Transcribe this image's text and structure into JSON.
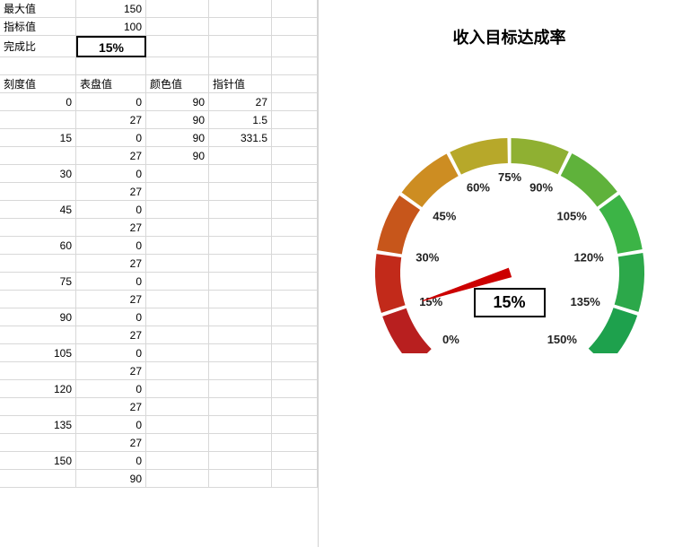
{
  "labels": {
    "max": "最大值",
    "target": "指标值",
    "completion": "完成比",
    "tick_col": "刻度值",
    "dial_col": "表盘值",
    "color_col": "颜色值",
    "needle_col": "指针值"
  },
  "values": {
    "max": "150",
    "target": "100",
    "completion": "15%"
  },
  "header_row": [
    "刻度值",
    "表盘值",
    "颜色值",
    "指针值"
  ],
  "data_rows": [
    [
      "0",
      "0",
      "90",
      "27"
    ],
    [
      "",
      "27",
      "90",
      "1.5"
    ],
    [
      "15",
      "0",
      "90",
      "331.5"
    ],
    [
      "",
      "27",
      "90",
      ""
    ],
    [
      "30",
      "0",
      "",
      ""
    ],
    [
      "",
      "27",
      "",
      ""
    ],
    [
      "45",
      "0",
      "",
      ""
    ],
    [
      "",
      "27",
      "",
      ""
    ],
    [
      "60",
      "0",
      "",
      ""
    ],
    [
      "",
      "27",
      "",
      ""
    ],
    [
      "75",
      "0",
      "",
      ""
    ],
    [
      "",
      "27",
      "",
      ""
    ],
    [
      "90",
      "0",
      "",
      ""
    ],
    [
      "",
      "27",
      "",
      ""
    ],
    [
      "105",
      "0",
      "",
      ""
    ],
    [
      "",
      "27",
      "",
      ""
    ],
    [
      "120",
      "0",
      "",
      ""
    ],
    [
      "",
      "27",
      "",
      ""
    ],
    [
      "135",
      "0",
      "",
      ""
    ],
    [
      "",
      "27",
      "",
      ""
    ],
    [
      "150",
      "0",
      "",
      ""
    ],
    [
      "",
      "90",
      "",
      ""
    ]
  ],
  "chart_data": {
    "type": "pie",
    "title": "收入目标达成率",
    "gauge": {
      "min_percent": 0,
      "max_percent": 150,
      "needle_percent": 15,
      "display_value": "15%",
      "ticks": [
        {
          "value": 0,
          "label": "0%"
        },
        {
          "value": 15,
          "label": "15%"
        },
        {
          "value": 30,
          "label": "30%"
        },
        {
          "value": 45,
          "label": "45%"
        },
        {
          "value": 60,
          "label": "60%"
        },
        {
          "value": 75,
          "label": "75%"
        },
        {
          "value": 90,
          "label": "90%"
        },
        {
          "value": 105,
          "label": "105%"
        },
        {
          "value": 120,
          "label": "120%"
        },
        {
          "value": 135,
          "label": "135%"
        },
        {
          "value": 150,
          "label": "150%"
        }
      ],
      "arc_colors": [
        "#b81f1f",
        "#cc2a1a",
        "#d6a020",
        "#a0b030",
        "#5bb040",
        "#2aa845"
      ]
    }
  }
}
